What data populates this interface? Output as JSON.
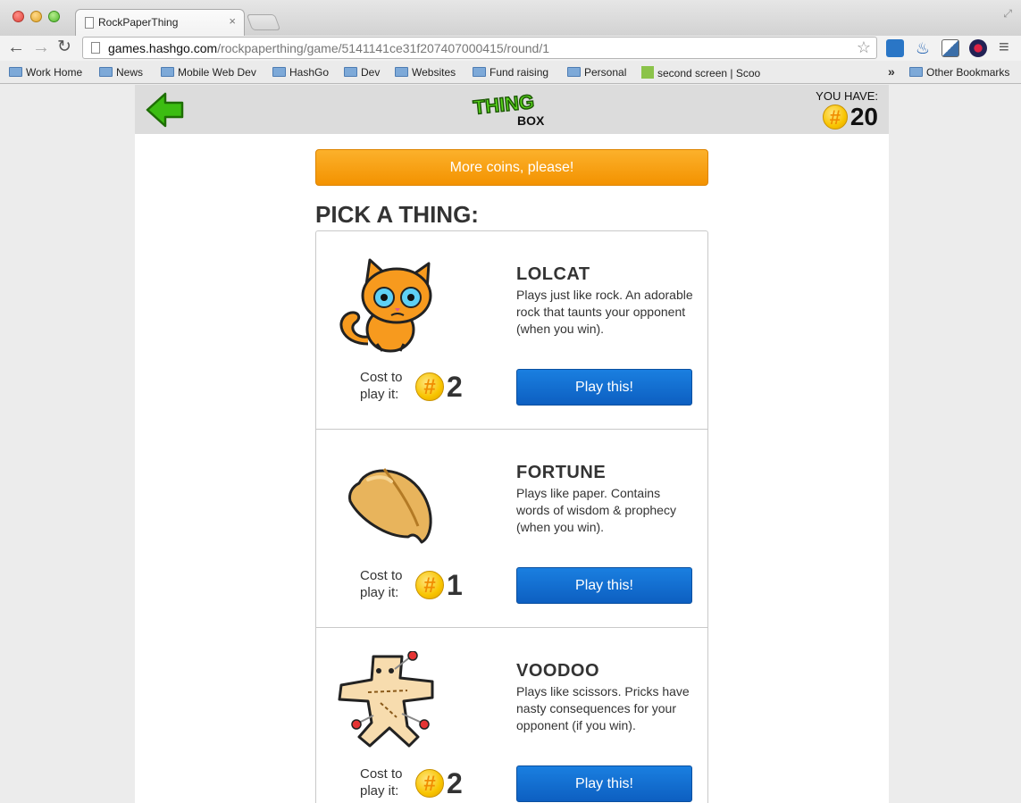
{
  "browser": {
    "tab_title": "RockPaperThing",
    "tab_close": "×",
    "url_host": "games.hashgo.com",
    "url_path": "/rockpaperthing/game/5141141ce31f207407000415/round/1",
    "bookmarks": [
      "Work Home",
      "News",
      "Mobile Web Dev",
      "HashGo",
      "Dev",
      "Websites",
      "Fund raising",
      "Personal",
      "second screen | Scoo",
      "Other Bookmarks"
    ],
    "more_bookmarks": "»"
  },
  "header": {
    "logo_top": "THING",
    "logo_bottom": "BOX",
    "you_have_label": "YOU HAVE:",
    "coin_symbol": "#",
    "coins": "20"
  },
  "main": {
    "more_coins_button": "More coins, please!",
    "heading": "PICK A THING:",
    "cost_label": "Cost to play it:",
    "things": [
      {
        "name": "LOLCAT",
        "description": "Plays just like rock. An adorable rock that taunts your opponent (when you win).",
        "cost": "2",
        "button": "Play this!",
        "icon": "cat-icon"
      },
      {
        "name": "FORTUNE",
        "description": "Plays like paper. Contains words of wisdom & prophecy (when you win).",
        "cost": "1",
        "button": "Play this!",
        "icon": "fortune-cookie-icon"
      },
      {
        "name": "VOODOO",
        "description": "Plays like scissors. Pricks have nasty consequences for your opponent (if you win).",
        "cost": "2",
        "button": "Play this!",
        "icon": "voodoo-doll-icon"
      }
    ]
  },
  "colors": {
    "orange_button": "#f39200",
    "play_button": "#1170d6",
    "logo_green": "#5bd81c",
    "coin_gold": "#f8c400"
  }
}
